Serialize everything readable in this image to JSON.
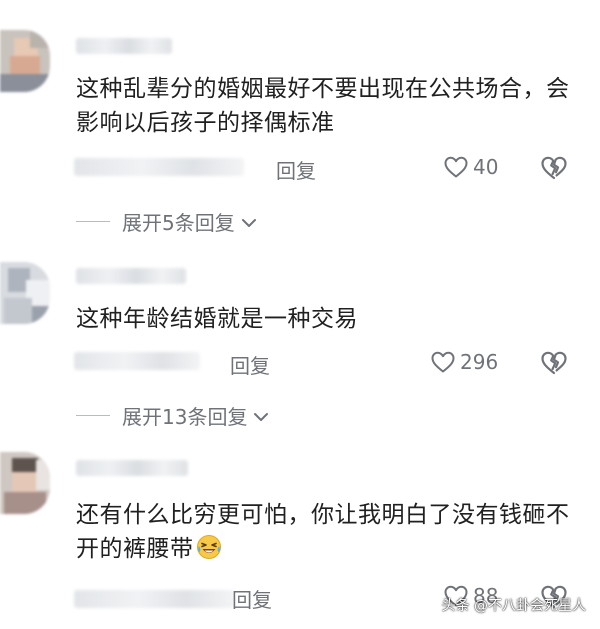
{
  "comments": [
    {
      "text": "这种乱辈分的婚姻最好不要出现在公共场合，会影响以后孩子的择偶标准",
      "reply_label": "回复",
      "likes": "40",
      "expand_label": "展开5条回复"
    },
    {
      "text": "这种年龄结婚就是一种交易",
      "reply_label": "回复",
      "likes": "296",
      "expand_label": "展开13条回复"
    },
    {
      "text": "还有什么比穷更可怕，你让我明白了没有钱砸不开的裤腰带",
      "reply_label": "回复",
      "likes": "88"
    }
  ],
  "watermark": "头条 @不八卦会死星人",
  "icons": {
    "like": "heart-outline-icon",
    "dislike": "broken-heart-icon",
    "expand": "chevron-down-icon",
    "emoji": "laughing-tears-emoji"
  },
  "colors": {
    "text": "#202020",
    "meta": "#6f7378",
    "background": "#ffffff"
  }
}
